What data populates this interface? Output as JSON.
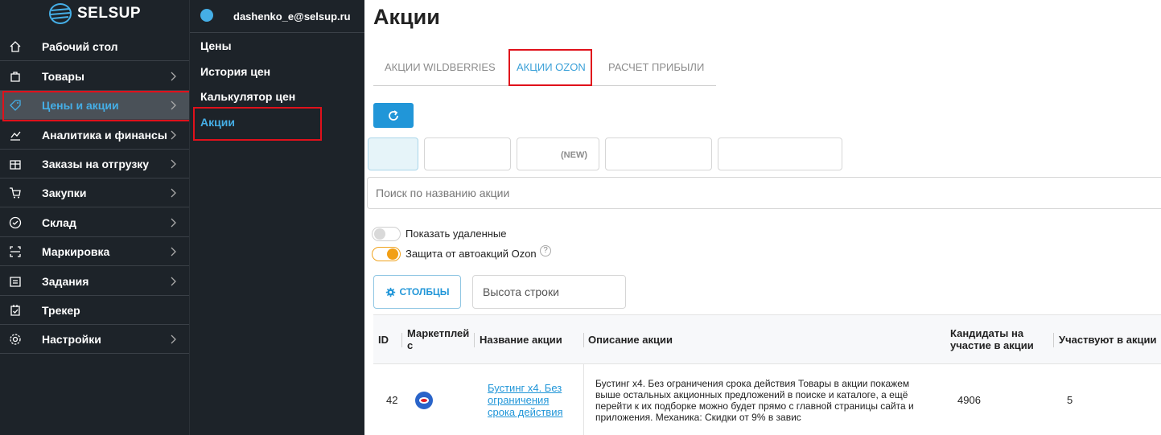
{
  "logo": {
    "text": "SELSUP"
  },
  "sidebar": {
    "items": [
      {
        "label": "Рабочий стол",
        "icon": "home-icon",
        "has_children": false
      },
      {
        "label": "Товары",
        "icon": "bag-icon",
        "has_children": true
      },
      {
        "label": "Цены и акции",
        "icon": "tag-icon",
        "has_children": true,
        "active": true
      },
      {
        "label": "Аналитика и финансы",
        "icon": "chart-icon",
        "has_children": true
      },
      {
        "label": "Заказы на отгрузку",
        "icon": "box-icon",
        "has_children": true
      },
      {
        "label": "Закупки",
        "icon": "cart-icon",
        "has_children": true
      },
      {
        "label": "Склад",
        "icon": "check-circle-icon",
        "has_children": true
      },
      {
        "label": "Маркировка",
        "icon": "scan-icon",
        "has_children": true
      },
      {
        "label": "Задания",
        "icon": "tasks-icon",
        "has_children": true
      },
      {
        "label": "Трекер",
        "icon": "tracker-icon",
        "has_children": false
      },
      {
        "label": "Настройки",
        "icon": "gear-icon",
        "has_children": true
      }
    ]
  },
  "submenu": {
    "user_email": "dashenko_e@selsup.ru",
    "items": [
      {
        "label": "Цены"
      },
      {
        "label": "История цен"
      },
      {
        "label": "Калькулятор цен"
      },
      {
        "label": "Акции",
        "active": true
      }
    ]
  },
  "main": {
    "title": "Акции",
    "tabs": [
      {
        "label": "АКЦИИ WILDBERRIES"
      },
      {
        "label": "АКЦИИ OZON",
        "active": true
      },
      {
        "label": "РАСЧЕТ ПРИБЫЛИ"
      }
    ],
    "filter_chips": [
      {
        "label": ""
      },
      {
        "label": ""
      },
      {
        "label": "(NEW)"
      },
      {
        "label": ""
      },
      {
        "label": ""
      }
    ],
    "search": {
      "placeholder": "Поиск по названию акции"
    },
    "toggles": [
      {
        "label": "Показать удаленные",
        "on": false
      },
      {
        "label": "Защита от автоакций Ozon",
        "on": true
      }
    ],
    "columns_button": "СТОЛБЦЫ",
    "row_height": {
      "placeholder": "Высота строки"
    }
  },
  "table": {
    "headers": {
      "id": "ID",
      "marketplace_1": "Маркетплей",
      "marketplace_2": "с",
      "name": "Название акции",
      "description": "Описание акции",
      "candidates_1": "Кандидаты на",
      "candidates_2": "участие в акции",
      "participating": "Участвуют в акции"
    },
    "rows": [
      {
        "id": "42",
        "name_lines": [
          "Бустинг x4. Без",
          "ограничения",
          "срока действия"
        ],
        "description_lines": [
          "Бустинг x4. Без ограничения срока действия Товары в акции покажем",
          "выше остальных акционных предложений в поиске и каталоге, а ещё",
          "перейти к их подборке можно будет прямо с главной страницы сайта и",
          "приложения. Механика: Скидки от 9% в завис"
        ],
        "candidates": "4906",
        "participating": "5"
      }
    ]
  },
  "colors": {
    "sidebar_bg": "#1d2329",
    "accent": "#2196d8",
    "active_text": "#45aee6",
    "highlight": "#e0111b",
    "toggle_on": "#f29f15"
  }
}
